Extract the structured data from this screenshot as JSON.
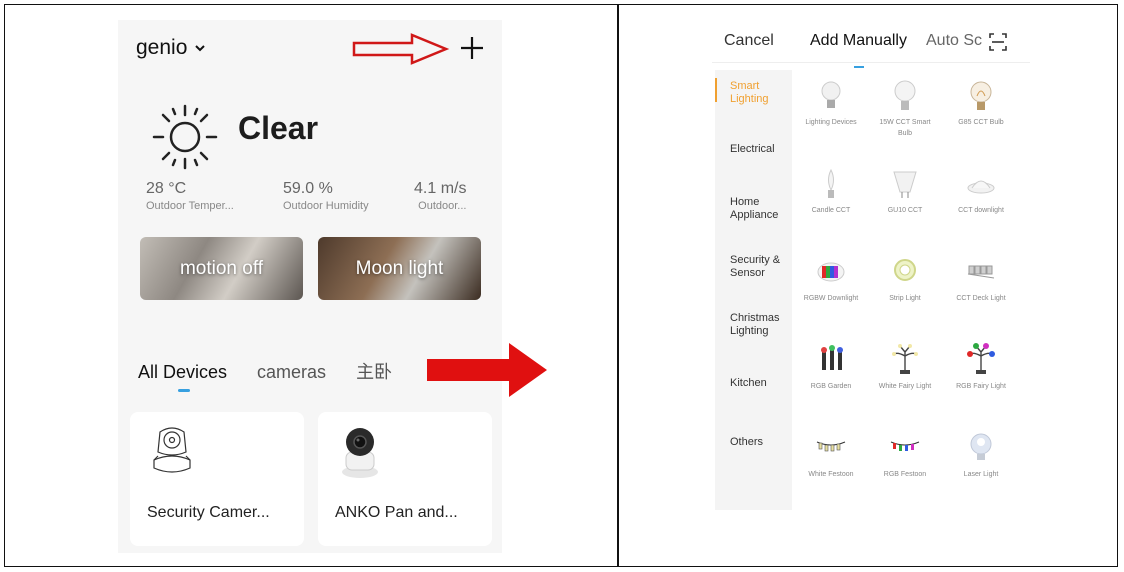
{
  "left_screen": {
    "home_name": "genio",
    "weather": {
      "condition": "Clear"
    },
    "stats": [
      {
        "value": "28 °C",
        "label": "Outdoor Temper..."
      },
      {
        "value": "59.0 %",
        "label": "Outdoor Humidity"
      },
      {
        "value": "4.1 m/s",
        "label": "Outdoor..."
      }
    ],
    "scenes": [
      {
        "label": "motion off"
      },
      {
        "label": "Moon light"
      }
    ],
    "tabs": [
      {
        "label": "All Devices",
        "active": true
      },
      {
        "label": "cameras"
      },
      {
        "label": "主卧"
      }
    ],
    "devices": [
      {
        "name": "Security Camer..."
      },
      {
        "name": "ANKO Pan and..."
      }
    ]
  },
  "right_screen": {
    "topbar": {
      "cancel": "Cancel",
      "add_manually": "Add Manually",
      "auto_scan": "Auto Sc"
    },
    "categories": [
      {
        "label": "Smart Lighting",
        "active": true
      },
      {
        "label": "Electrical"
      },
      {
        "label": "Home Appliance"
      },
      {
        "label": "Security & Sensor"
      },
      {
        "label": "Christmas Lighting"
      },
      {
        "label": "Kitchen"
      },
      {
        "label": "Others"
      }
    ],
    "products": [
      {
        "name": "Lighting Devices",
        "icon": "bulb-icon"
      },
      {
        "name": "15W CCT Smart Bulb",
        "icon": "bulb-icon"
      },
      {
        "name": "G85 CCT Bulb",
        "icon": "filament-bulb-icon"
      },
      {
        "name": "Candle CCT",
        "icon": "candle-bulb-icon"
      },
      {
        "name": "GU10 CCT",
        "icon": "gu10-icon"
      },
      {
        "name": "CCT downlight",
        "icon": "downlight-icon"
      },
      {
        "name": "RGBW Downlight",
        "icon": "rgbw-downlight-icon"
      },
      {
        "name": "Strip Light",
        "icon": "strip-light-icon"
      },
      {
        "name": "CCT Deck Light",
        "icon": "deck-light-icon"
      },
      {
        "name": "RGB Garden",
        "icon": "garden-light-icon"
      },
      {
        "name": "White Fairy Light",
        "icon": "fairy-light-icon"
      },
      {
        "name": "RGB Fairy Light",
        "icon": "rgb-fairy-light-icon"
      },
      {
        "name": "White Festoon",
        "icon": "festoon-icon"
      },
      {
        "name": "RGB Festoon",
        "icon": "rgb-festoon-icon"
      },
      {
        "name": "Laser Light",
        "icon": "laser-light-icon"
      }
    ]
  },
  "colors": {
    "accent_blue": "#37a0e0",
    "category_active": "#f0a030",
    "arrow_red": "#e01010"
  }
}
